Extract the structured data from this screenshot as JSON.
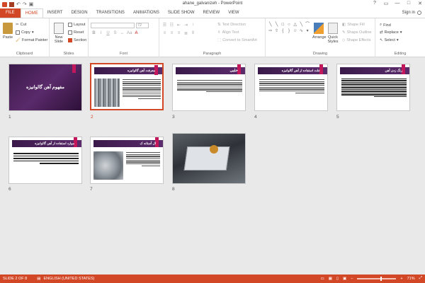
{
  "window": {
    "title": "ahane_galvanizeh - PowerPoint",
    "controls": [
      "?",
      "▭",
      "—",
      "□",
      "✕"
    ]
  },
  "tabs": [
    {
      "label": "FILE",
      "kind": "file"
    },
    {
      "label": "HOME",
      "kind": "active"
    },
    {
      "label": "INSERT"
    },
    {
      "label": "DESIGN"
    },
    {
      "label": "TRANSITIONS"
    },
    {
      "label": "ANIMATIONS"
    },
    {
      "label": "SLIDE SHOW"
    },
    {
      "label": "REVIEW"
    },
    {
      "label": "VIEW"
    }
  ],
  "signin": "Sign in",
  "ribbon": {
    "clipboard": {
      "label": "Clipboard",
      "paste": "Paste",
      "cut": "Cut",
      "copy": "Copy",
      "format_painter": "Format Painter"
    },
    "slides": {
      "label": "Slides",
      "new_slide": "New Slide",
      "layout": "Layout",
      "reset": "Reset",
      "section": "Section"
    },
    "font": {
      "label": "Font",
      "size": "72"
    },
    "paragraph": {
      "label": "Paragraph",
      "text_direction": "Text Direction",
      "align_text": "Align Text",
      "convert": "Convert to SmartArt"
    },
    "drawing": {
      "label": "Drawing",
      "arrange": "Arrange",
      "quick_styles": "Quick Styles",
      "shape_fill": "Shape Fill",
      "shape_outline": "Shape Outline",
      "shape_effects": "Shape Effects"
    },
    "editing": {
      "label": "Editing",
      "find": "Find",
      "replace": "Replace",
      "select": "Select"
    }
  },
  "slides": [
    {
      "num": "1",
      "title": "مفهوم آهن گالوانیزه"
    },
    {
      "num": "2",
      "title": "معرفت آهن گالوانیزه"
    },
    {
      "num": "3",
      "title": "حلبی"
    },
    {
      "num": "4",
      "title": "علت استفاده از آهن گالوانیزه"
    },
    {
      "num": "5",
      "title": "رنگ زدن آهن"
    },
    {
      "num": "6",
      "title": "موارد استفاده از آهن گالوانیزه"
    },
    {
      "num": "7",
      "title": "ال آستانه ک"
    },
    {
      "num": "8",
      "title": ""
    }
  ],
  "status": {
    "slide": "SLIDE 2 OF 8",
    "language": "ENGLISH (UNITED STATES)",
    "zoom": "71%",
    "zoom_level": 0.6
  },
  "colors": {
    "accent": "#d24726",
    "slide_purple": "#3a1a4a",
    "pink": "#c2185b"
  }
}
